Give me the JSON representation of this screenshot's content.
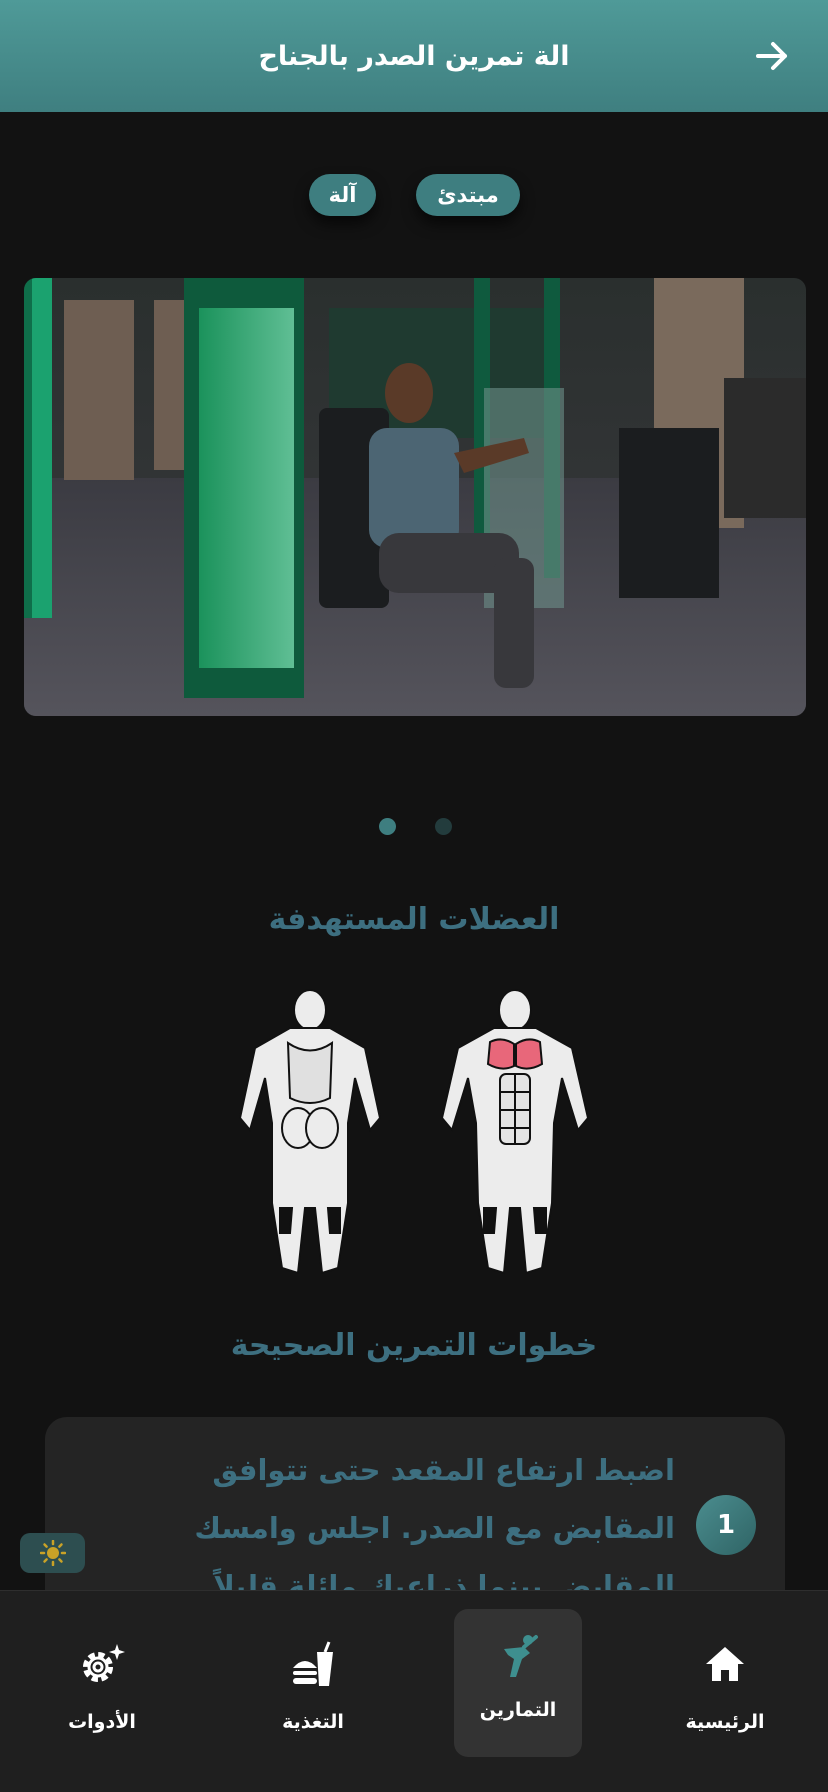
{
  "header": {
    "title": "الة تمرين الصدر بالجناح",
    "back_icon": "arrow-right-icon"
  },
  "tags": {
    "level": "مبتدئ",
    "type": "آلة"
  },
  "carousel": {
    "active_index": 0,
    "count": 2
  },
  "muscles": {
    "title": "العضلات المستهدفة",
    "highlighted": "chest",
    "highlight_color": "#e8677a"
  },
  "steps": {
    "title": "خطوات التمرين الصحيحة",
    "items": [
      {
        "number": "1",
        "text": "اضبط ارتفاع المقعد حتى تتوافق المقابض مع الصدر. اجلس وامسك المقابض بينما ذراعيك مائلة قليلاً"
      }
    ]
  },
  "theme_toggle": {
    "icon": "sun-icon"
  },
  "nav": {
    "home": "الرئيسية",
    "workouts": "التمارين",
    "nutrition": "التغذية",
    "tools": "الأدوات",
    "active": "workouts"
  },
  "colors": {
    "accent": "#3e7e80",
    "header": "#4f9a98",
    "background": "#121212",
    "muted_text": "#3d6f80"
  }
}
